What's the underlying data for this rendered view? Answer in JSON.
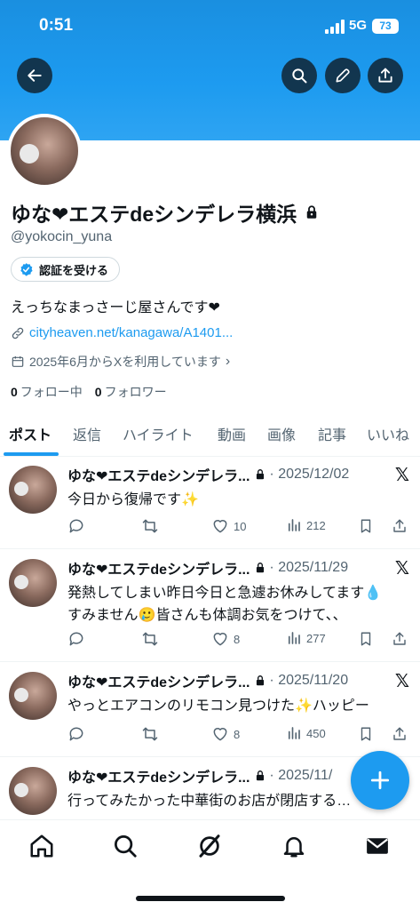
{
  "status_bar": {
    "time": "0:51",
    "network": "5G",
    "battery": "73"
  },
  "profile": {
    "name": "ゆな❤エステdeシンデレラ横浜",
    "handle": "@yokocin_yuna",
    "verify_label": "認証を受ける",
    "bio": "えっちなまっさーじ屋さんです❤",
    "link": "cityheaven.net/kanagawa/A1401...",
    "joined": "2025年6月からXを利用しています",
    "following_count": "0",
    "following_label": "フォロー中",
    "followers_count": "0",
    "followers_label": "フォロワー"
  },
  "tabs": [
    "ポスト",
    "返信",
    "ハイライト",
    "動画",
    "画像",
    "記事",
    "いいね"
  ],
  "posts": [
    {
      "name": "ゆな❤エステdeシンデレラ...",
      "date": "· 2025/12/02",
      "text1": "今日から復帰です✨",
      "text2": "",
      "likes": "10",
      "views": "212"
    },
    {
      "name": "ゆな❤エステdeシンデレラ...",
      "date": "· 2025/11/29",
      "text1": "発熱してしまい昨日今日と急遽お休みしてます💧",
      "text2": "すみません🥲皆さんも体調お気をつけて、、",
      "likes": "8",
      "views": "277"
    },
    {
      "name": "ゆな❤エステdeシンデレラ...",
      "date": "· 2025/11/20",
      "text1": "やっとエアコンのリモコン見つけた✨ハッピー",
      "text2": "",
      "likes": "8",
      "views": "450"
    },
    {
      "name": "ゆな❤エステdeシンデレラ...",
      "date": "· 2025/11/",
      "text1": "行ってみたかった中華街のお店が閉店する…",
      "text2": "",
      "likes": "",
      "views": ""
    }
  ],
  "icons": {
    "back": "arrow-left-icon",
    "search": "search-icon",
    "edit": "pencil-icon",
    "share": "share-icon",
    "lock": "lock-icon",
    "verified": "verified-badge-icon",
    "link": "link-icon",
    "calendar": "calendar-icon",
    "x_logo": "x-logo-icon",
    "reply": "reply-icon",
    "repost": "repost-icon",
    "like": "heart-icon",
    "views": "views-icon",
    "bookmark": "bookmark-icon",
    "post_share": "share-icon",
    "compose": "plus-icon",
    "nav": [
      "home-icon",
      "search-icon",
      "grok-icon",
      "bell-icon",
      "mail-icon"
    ]
  },
  "colors": {
    "accent": "#1d9bf0",
    "text": "#0f1419",
    "muted": "#536471"
  }
}
